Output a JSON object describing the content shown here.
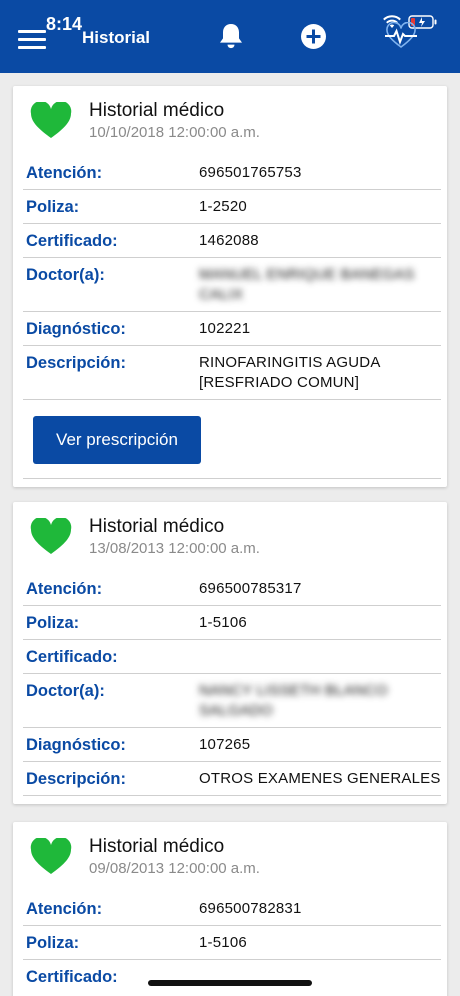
{
  "status": {
    "time": "8:14"
  },
  "header": {
    "title": "Historial",
    "menu_icon": "hamburger-menu-icon",
    "bell_icon": "bell-icon",
    "add_icon": "plus-circle-icon",
    "pulse_icon": "heart-pulse-icon"
  },
  "colors": {
    "brand": "#0a4aa4",
    "heart": "#1fb83a",
    "divider": "#cfcfcf"
  },
  "labels": {
    "atencion": "Atención:",
    "poliza": "Poliza:",
    "certificado": "Certificado:",
    "doctor": "Doctor(a):",
    "diagnostico": "Diagnóstico:",
    "descripcion": "Descripción:"
  },
  "records": [
    {
      "title": "Historial médico",
      "date": "10/10/2018 12:00:00 a.m.",
      "atencion": "696501765753",
      "poliza": "1-2520",
      "certificado": "1462088",
      "doctor": "MANUEL ENRIQUE BANEGAS CALIX",
      "diagnostico": "102221",
      "descripcion": "RINOFARINGITIS AGUDA [RESFRIADO COMUN]",
      "button": "Ver prescripción"
    },
    {
      "title": "Historial médico",
      "date": "13/08/2013 12:00:00 a.m.",
      "atencion": "696500785317",
      "poliza": "1-5106",
      "certificado": "",
      "doctor": "NANCY LISSETH BLANCO SALGADO",
      "diagnostico": "107265",
      "descripcion": "OTROS EXAMENES GENERALES"
    },
    {
      "title": "Historial médico",
      "date": "09/08/2013 12:00:00 a.m.",
      "atencion": "696500782831",
      "poliza": "1-5106",
      "certificado": ""
    }
  ]
}
